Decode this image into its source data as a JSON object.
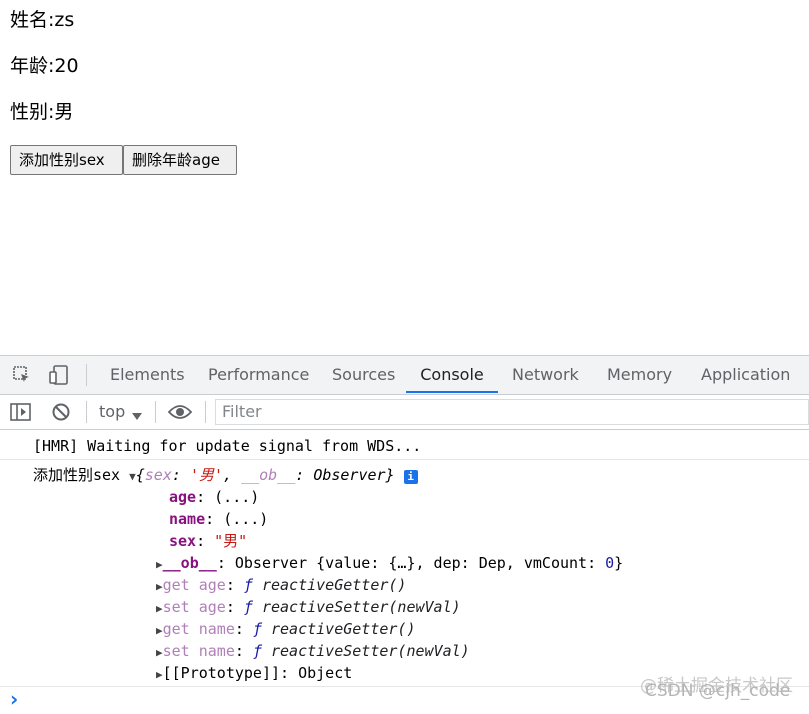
{
  "page": {
    "name_line": "姓名:zs",
    "age_line": "年龄:20",
    "sex_line": "性别:男",
    "add_button": "添加性别sex",
    "delete_button": "删除年龄age"
  },
  "devtools": {
    "tabs": [
      "Elements",
      "Performance",
      "Sources",
      "Console",
      "Network",
      "Memory",
      "Application"
    ],
    "active_tab": "Console",
    "context": "top",
    "filter_placeholder": "Filter",
    "console": {
      "hmr_message": "[HMR] Waiting for update signal from WDS...",
      "log_label": "添加性别sex",
      "summary_open": "{",
      "summary_sex_key": "sex",
      "summary_sex_val": "'男'",
      "summary_ob_key": "__ob__",
      "summary_ob_val": "Observer}",
      "prop_age_key": "age",
      "prop_age_val": "(...)",
      "prop_name_key": "name",
      "prop_name_val": "(...)",
      "prop_sex_key": "sex",
      "prop_sex_val": "\"男\"",
      "ob_key": "__ob__",
      "ob_val_pre": "Observer {value: {…}, dep: Dep, vmCount: ",
      "ob_val_num": "0",
      "ob_val_post": "}",
      "get_age_key": "get age",
      "get_age_fn": "reactiveGetter()",
      "set_age_key": "set age",
      "set_age_fn": "reactiveSetter(newVal)",
      "get_name_key": "get name",
      "get_name_fn": "reactiveGetter()",
      "set_name_key": "set name",
      "set_name_fn": "reactiveSetter(newVal)",
      "prototype_key": "[[Prototype]]",
      "prototype_val": "Object",
      "prompt": "›"
    }
  },
  "watermarks": [
    "@稀土掘金技术社区",
    "CSDN @cjh_code"
  ],
  "icons": [
    "inspect-element-icon",
    "device-toolbar-icon",
    "sidebar-toggle-icon",
    "clear-console-icon",
    "dropdown-icon",
    "eye-icon",
    "info-icon",
    "expand-triangle-icon",
    "prompt-chevron-icon"
  ]
}
